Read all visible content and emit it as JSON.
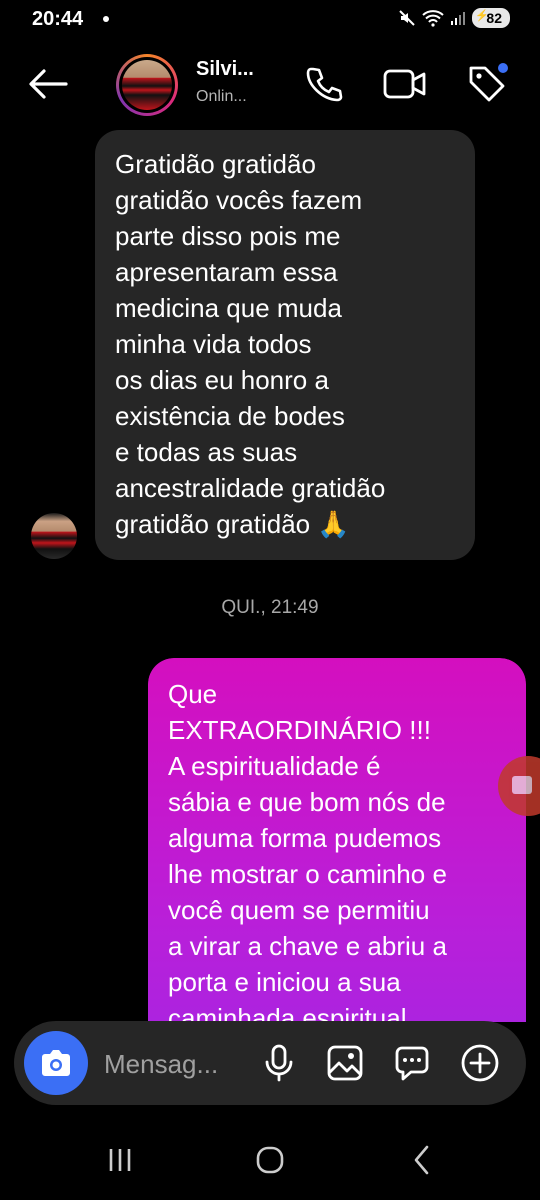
{
  "status_bar": {
    "time": "20:44",
    "battery": "82"
  },
  "header": {
    "contact_name": "Silvi...",
    "contact_status": "Onlin..."
  },
  "messages": {
    "incoming_text": "Gratidão gratidão\ngratidão vocês fazem\nparte disso pois me\napresentaram essa\nmedicina que muda\nminha vida todos\nos dias eu honro a\nexistência de bodes\ne todas as suas\nancestralidade gratidão\ngratidão gratidão 🙏",
    "timestamp": "QUI., 21:49",
    "outgoing_text": "Que\nEXTRAORDINÁRIO !!!\nA espiritualidade é\nsábia e que bom nós de\nalguma forma pudemos\nlhe mostrar o caminho e\nvocê quem se permitiu\na virar a chave e abriu a\nporta e iniciou a sua\ncaminhada espiritual"
  },
  "composer": {
    "placeholder": "Mensag..."
  },
  "colors": {
    "accent": "#3b6ff5",
    "outgoing_top": "#d40fbf",
    "outgoing_bottom": "#9e28e6",
    "incoming_bg": "#262626"
  },
  "icons": [
    "back-arrow-icon",
    "phone-icon",
    "video-camera-icon",
    "tag-icon",
    "camera-icon",
    "microphone-icon",
    "image-icon",
    "sticker-icon",
    "plus-circle-icon",
    "recent-apps-icon",
    "home-icon",
    "back-icon"
  ]
}
